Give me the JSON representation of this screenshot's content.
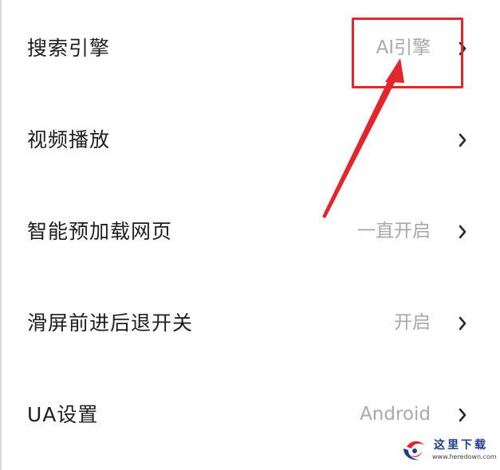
{
  "settings": {
    "rows": [
      {
        "label": "搜索引擎",
        "value": "AI引擎"
      },
      {
        "label": "视频播放",
        "value": ""
      },
      {
        "label": "智能预加载网页",
        "value": "一直开启"
      },
      {
        "label": "滑屏前进后退开关",
        "value": "开启"
      },
      {
        "label": "UA设置",
        "value": "Android"
      }
    ]
  },
  "annotation": {
    "color": "#e3262c",
    "highlighted_row": "搜索引擎"
  },
  "watermark": {
    "title": "这里下载",
    "url": "www.heredown.com"
  },
  "icons": {
    "row_chevron": "chevron-right-icon",
    "watermark_logo": "swirl-logo-icon"
  }
}
